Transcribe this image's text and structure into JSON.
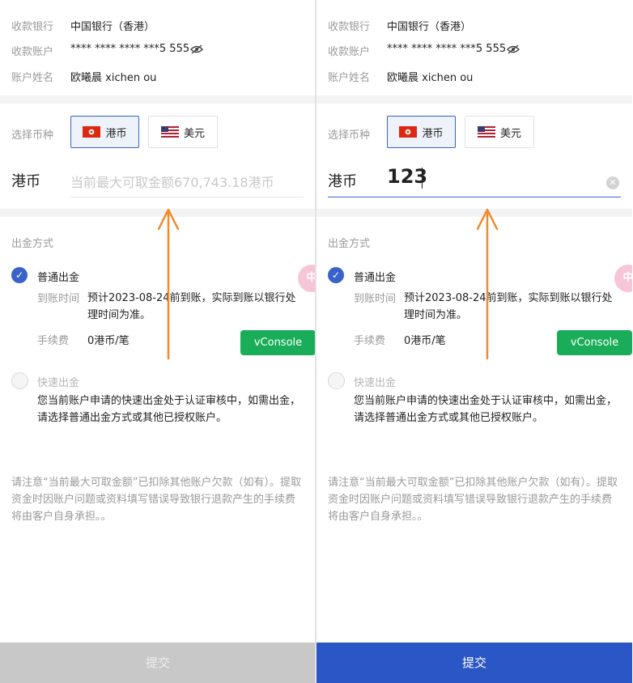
{
  "bank_info": {
    "bank_label": "收款银行",
    "bank_value": "中国银行（香港）",
    "account_label": "收款账户",
    "account_value": "**** **** **** ***5 555",
    "name_label": "账户姓名",
    "name_value": "欧曦晨 xichen ou"
  },
  "currency": {
    "label": "选择币种",
    "options": [
      {
        "label": "港币",
        "flag": "hk-flag-icon"
      },
      {
        "label": "美元",
        "flag": "us-flag-icon"
      }
    ],
    "selected": "港币"
  },
  "amount": {
    "currency": "港币",
    "placeholder": "当前最大可取金额670,743.18港币",
    "entered_value": "123"
  },
  "withdraw_method": {
    "title": "出金方式",
    "normal": {
      "label": "普通出金",
      "time_label": "到账时间",
      "time_value": "预计2023-08-24前到账，实际到账以银行处理时间为准。",
      "fee_label": "手续费",
      "fee_value": "0港币/笔"
    },
    "fast": {
      "label": "快速出金",
      "desc": "您当前账户申请的快速出金处于认证审核中，如需出金，请选择普通出金方式或其他已授权账户。"
    }
  },
  "notice": "请注意“当前最大可取金额”已扣除其他账户欠款（如有）。提取资金时因账户问题或资料填写错误导致银行退款产生的手续费将由客户自身承担。。",
  "submit_label": "提交",
  "vconsole_label": "vConsole",
  "lang_bubble": "中",
  "colors": {
    "accent": "#3a63c9",
    "submit_active": "#2a56c6",
    "submit_disabled": "#c8c8c8",
    "vconsole": "#1aad59",
    "annotation_arrow": "#f08a2c"
  }
}
